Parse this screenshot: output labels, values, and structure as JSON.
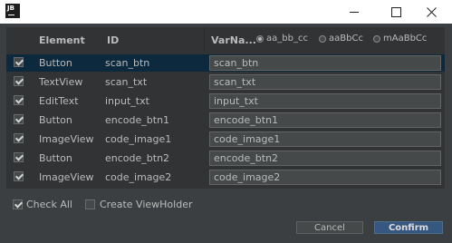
{
  "window": {
    "logo_text": "JB",
    "controls": [
      "minimize",
      "maximize",
      "close"
    ]
  },
  "table": {
    "headers": {
      "element": "Element",
      "id": "ID",
      "varname": "VarNa..."
    },
    "radio_options": [
      {
        "label": "aa_bb_cc",
        "selected": true
      },
      {
        "label": "aaBbCc",
        "selected": false
      },
      {
        "label": "mAaBbCc",
        "selected": false
      }
    ],
    "rows": [
      {
        "checked": true,
        "element": "Button",
        "id": "scan_btn",
        "varname": "scan_btn",
        "selected": true
      },
      {
        "checked": true,
        "element": "TextView",
        "id": "scan_txt",
        "varname": "scan_txt",
        "selected": false
      },
      {
        "checked": true,
        "element": "EditText",
        "id": "input_txt",
        "varname": "input_txt",
        "selected": false
      },
      {
        "checked": true,
        "element": "Button",
        "id": "encode_btn1",
        "varname": "encode_btn1",
        "selected": false
      },
      {
        "checked": true,
        "element": "ImageView",
        "id": "code_image1",
        "varname": "code_image1",
        "selected": false
      },
      {
        "checked": true,
        "element": "Button",
        "id": "encode_btn2",
        "varname": "encode_btn2",
        "selected": false
      },
      {
        "checked": true,
        "element": "ImageView",
        "id": "code_image2",
        "varname": "code_image2",
        "selected": false
      }
    ]
  },
  "options": {
    "check_all": {
      "label": "Check All",
      "checked": true
    },
    "create_viewholder": {
      "label": "Create ViewHolder",
      "checked": false
    }
  },
  "buttons": {
    "cancel": "Cancel",
    "confirm": "Confirm"
  },
  "colors": {
    "background": "#3c3f41",
    "table_bg": "#313335",
    "selected_row": "#0d293e",
    "confirm_bg": "#365880"
  }
}
